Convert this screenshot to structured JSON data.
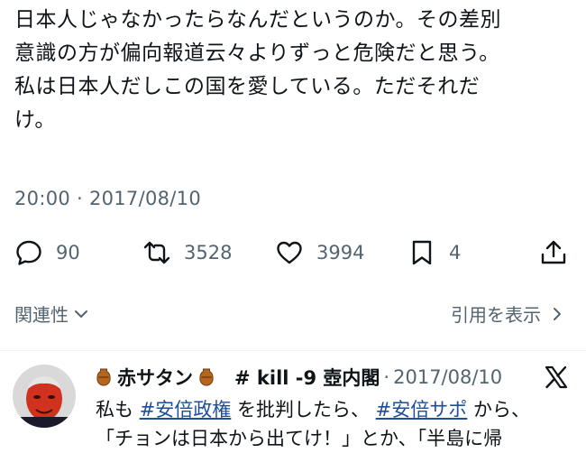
{
  "tweet": {
    "lines": [
      "日本人じゃなかったらなんだというのか。その差別",
      "意識の方が偏向報道云々よりずっと危険だと思う。",
      "私は日本人だしこの国を愛している。ただそれだ",
      "け。"
    ],
    "timestamp": "20:00 · 2017/08/10"
  },
  "actions": {
    "reply_count": "90",
    "retweet_count": "3528",
    "like_count": "3994",
    "bookmark_count": "4",
    "reply_icon": "speech-bubble-icon",
    "retweet_icon": "retweet-icon",
    "like_icon": "heart-icon",
    "bookmark_icon": "bookmark-icon",
    "share_icon": "share-icon"
  },
  "footer": {
    "related_label": "関連性",
    "quotes_label": "引用を表示"
  },
  "quoted": {
    "name": "赤サタン",
    "handle": "# kill -9 壺内閣",
    "separator": "·",
    "date": "2017/08/10",
    "body_prefix": "私も ",
    "hashtag1": "#安倍政権",
    "body_middle": " を批判したら、 ",
    "hashtag2": "#安倍サポ",
    "body_suffix": " から、",
    "line2": "「チョンは日本から出てけ！」とか、「半島に帰"
  },
  "colors": {
    "text": "#0f1419",
    "secondary": "#536471",
    "hashtag": "#1d4e9b"
  }
}
